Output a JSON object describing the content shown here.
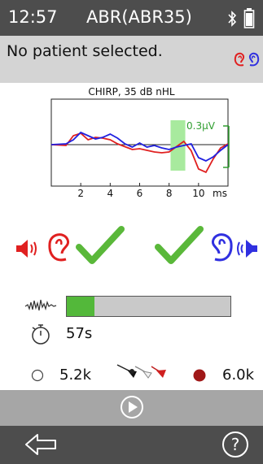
{
  "status": {
    "time": "12:57",
    "title": "ABR(ABR35)",
    "icons": [
      "bluetooth-icon",
      "battery-icon"
    ]
  },
  "patient": {
    "text": "No patient selected.",
    "icons": [
      "left-ear-icon",
      "right-ear-icon"
    ]
  },
  "chart_data": {
    "type": "line",
    "title": "CHIRP,  35 dB nHL",
    "xlabel": "ms",
    "x_ticks": [
      "2",
      "4",
      "6",
      "8",
      "10",
      "ms"
    ],
    "xlim": [
      0,
      12
    ],
    "highlight_band_ms": [
      8.1,
      9.1
    ],
    "scale_bar_label": "0.3µV",
    "series": [
      {
        "color": "#e02020",
        "x": [
          0,
          1,
          1.5,
          2,
          2.5,
          3,
          3.5,
          4,
          4.5,
          5,
          5.5,
          6,
          6.5,
          7,
          7.5,
          8,
          8.5,
          9,
          9.5,
          10,
          10.5,
          11,
          11.5,
          12
        ],
        "y": [
          0,
          -0.02,
          0.22,
          0.28,
          0.12,
          0.18,
          0.16,
          0.12,
          0.02,
          -0.05,
          -0.12,
          -0.1,
          -0.14,
          -0.18,
          -0.2,
          -0.18,
          -0.05,
          0.08,
          -0.15,
          -0.6,
          -0.68,
          -0.35,
          -0.08,
          0.02
        ]
      },
      {
        "color": "#2020e0",
        "x": [
          0,
          1,
          1.5,
          2,
          2.5,
          3,
          3.5,
          4,
          4.5,
          5,
          5.5,
          6,
          6.5,
          7,
          7.5,
          8,
          8.5,
          9,
          9.5,
          10,
          10.5,
          11,
          11.5,
          12
        ],
        "y": [
          0,
          0.02,
          0.12,
          0.3,
          0.22,
          0.14,
          0.18,
          0.26,
          0.16,
          0.02,
          -0.06,
          0.04,
          -0.06,
          -0.02,
          -0.08,
          -0.12,
          -0.06,
          -0.02,
          0.02,
          -0.32,
          -0.4,
          -0.3,
          -0.14,
          0.0
        ]
      }
    ]
  },
  "stimulus": {
    "left_ear_status": "check",
    "right_ear_status": "check"
  },
  "progress": {
    "value": 0.17,
    "fill_color": "#53b83a"
  },
  "timer": {
    "value": "57s"
  },
  "impedance": {
    "left_value": "5.2k",
    "right_value": "6.0k",
    "colors": {
      "left": "#ffffff",
      "right": "#a01818"
    }
  }
}
